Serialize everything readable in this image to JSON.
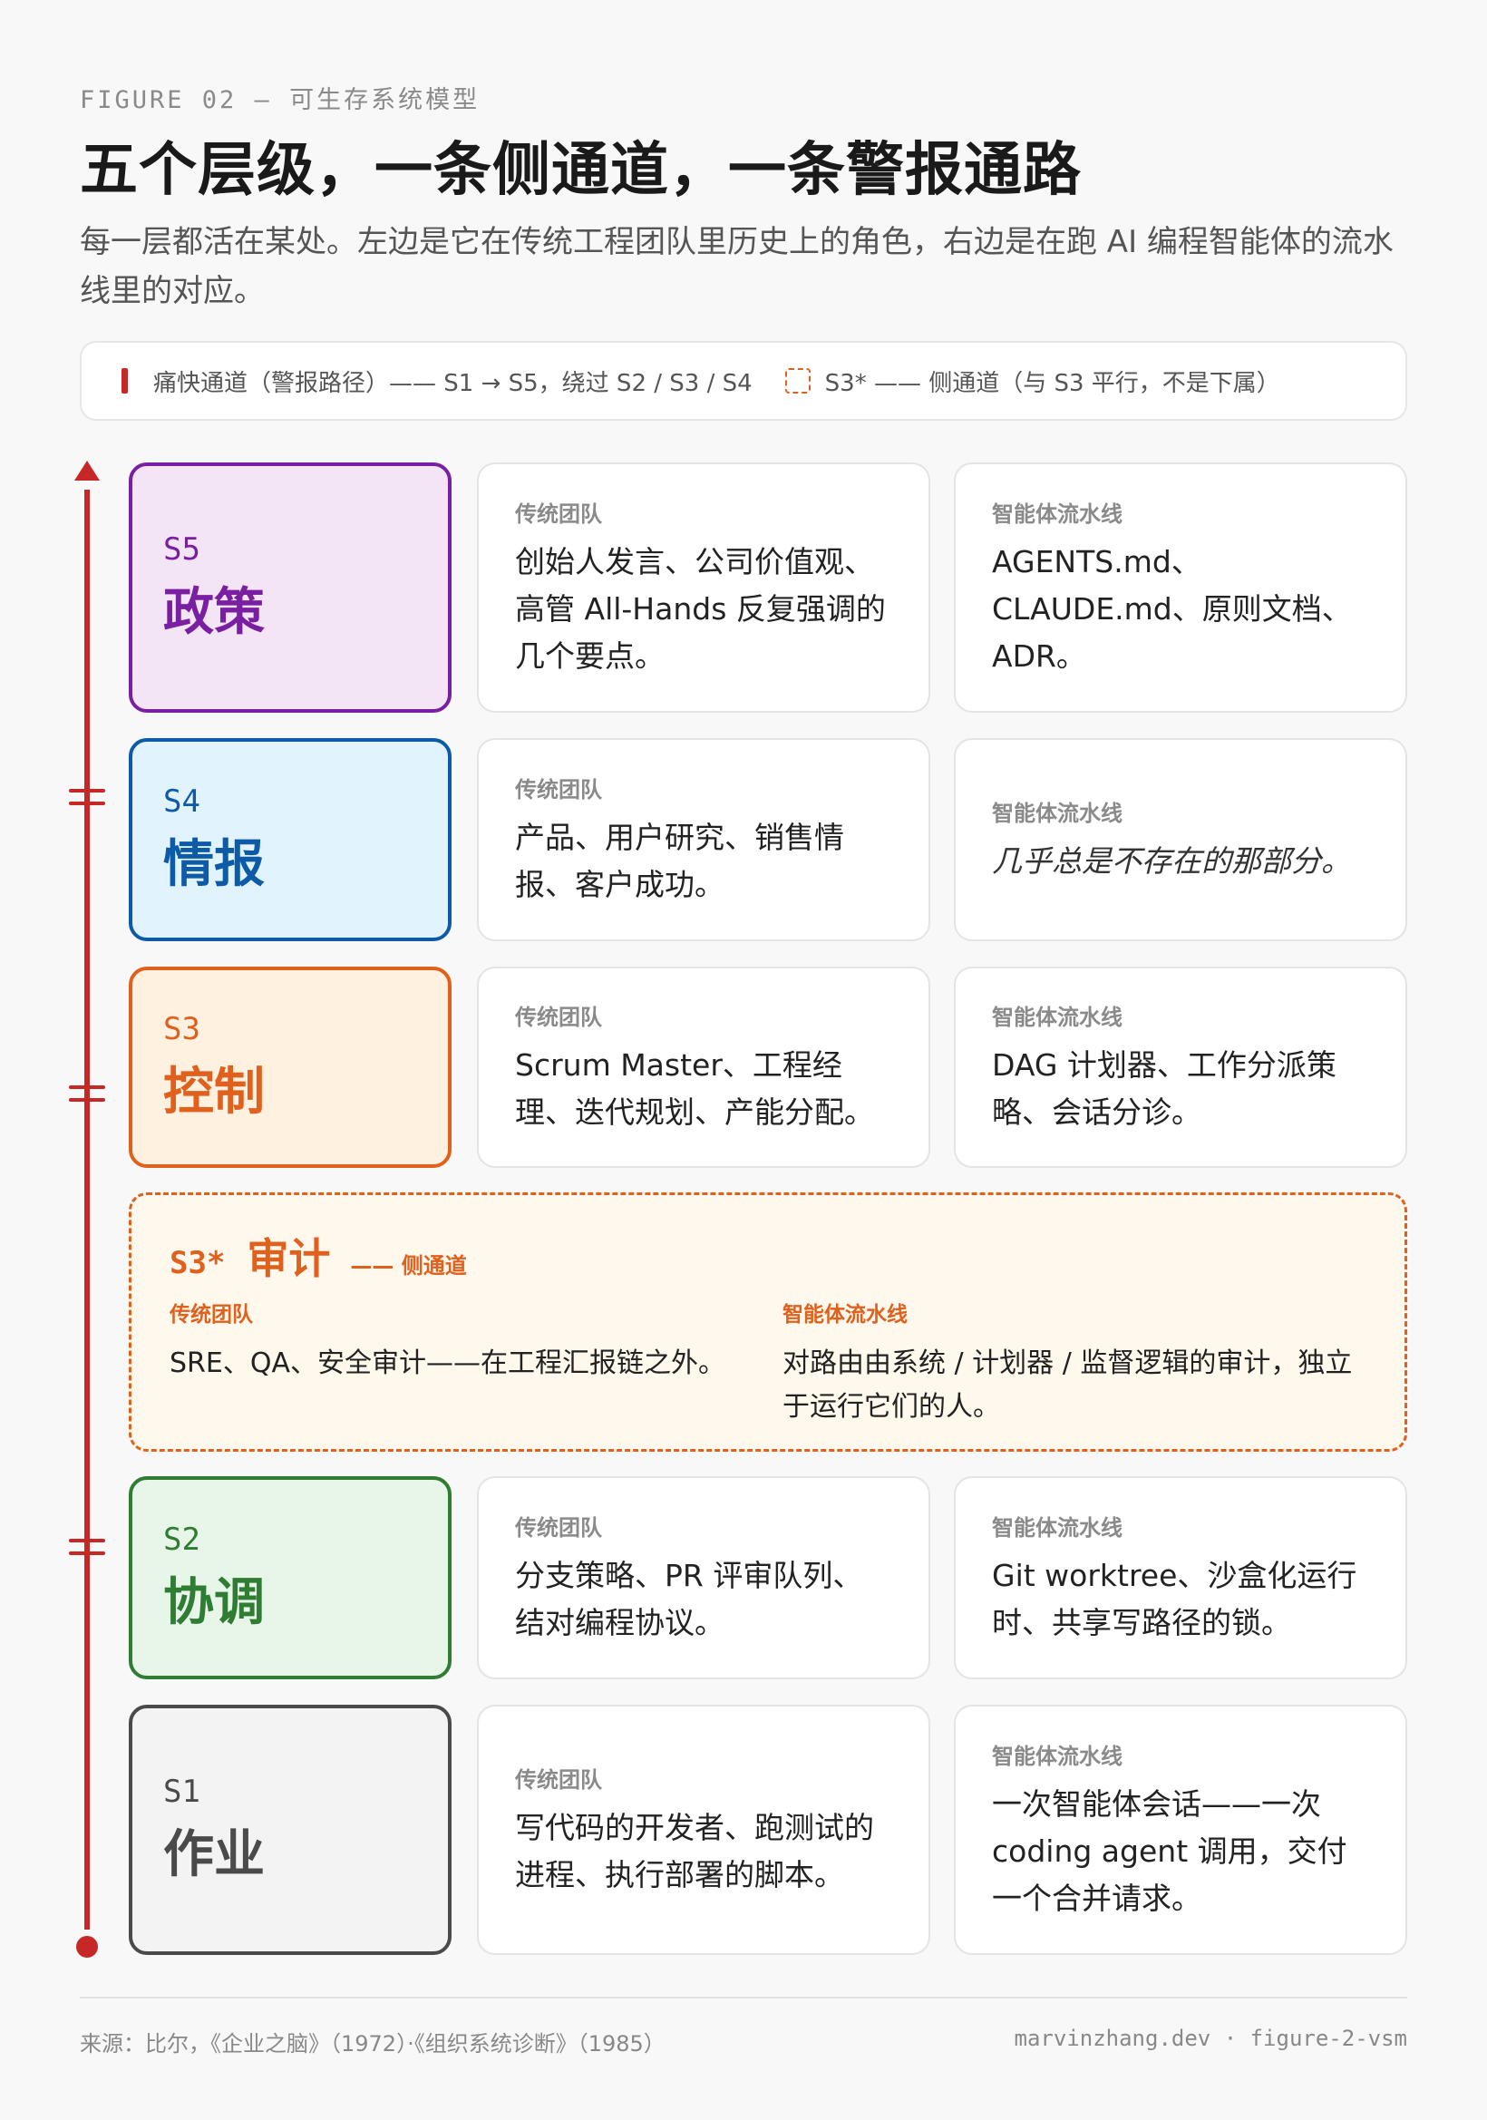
{
  "header": {
    "kicker": "FIGURE 02 — 可生存系统模型",
    "title": "五个层级，一条侧通道，一条警报通路",
    "subtitle": "每一层都活在某处。左边是它在传统工程团队里历史上的角色，右边是在跑 AI 编程智能体的流水线里的对应。"
  },
  "legend": {
    "algedonic": "痛快通道（警报路径）—— S1 → S5，绕过 S2 / S3 / S4",
    "side_channel": "S3* —— 侧通道（与 S3 平行，不是下属）"
  },
  "colors": {
    "alarm": "#c62828",
    "s5": "#7b1fa2",
    "s4": "#0d5aa7",
    "s3": "#e0601e",
    "s2": "#2e7d32",
    "s1": "#4a4a4a"
  },
  "col_labels": {
    "traditional": "传统团队",
    "agent": "智能体流水线"
  },
  "levels": [
    {
      "code": "S5",
      "name": "政策",
      "traditional": "创始人发言、公司价值观、高管 All-Hands 反复强调的几个要点。",
      "agent": "AGENTS.md、CLAUDE.md、原则文档、ADR。"
    },
    {
      "code": "S4",
      "name": "情报",
      "traditional": "产品、用户研究、销售情报、客户成功。",
      "agent": "几乎总是不存在的那部分。"
    },
    {
      "code": "S3",
      "name": "控制",
      "traditional": "Scrum Master、工程经理、迭代规划、产能分配。",
      "agent": "DAG 计划器、工作分派策略、会话分诊。"
    },
    {
      "code": "S2",
      "name": "协调",
      "traditional": "分支策略、PR 评审队列、结对编程协议。",
      "agent": "Git worktree、沙盒化运行时、共享写路径的锁。"
    },
    {
      "code": "S1",
      "name": "作业",
      "traditional": "写代码的开发者、跑测试的进程、执行部署的脚本。",
      "agent": "一次智能体会话——一次 coding agent 调用，交付一个合并请求。"
    }
  ],
  "audit": {
    "code": "S3*",
    "name": "审计",
    "side_label": "—— 侧通道",
    "traditional": "SRE、QA、安全审计——在工程汇报链之外。",
    "agent": "对路由由系统 / 计划器 / 监督逻辑的审计，独立于运行它们的人。"
  },
  "footer": {
    "source": "来源：比尔，《企业之脑》（1972）·《组织系统诊断》（1985）",
    "credit": "marvinzhang.dev · figure-2-vsm"
  }
}
